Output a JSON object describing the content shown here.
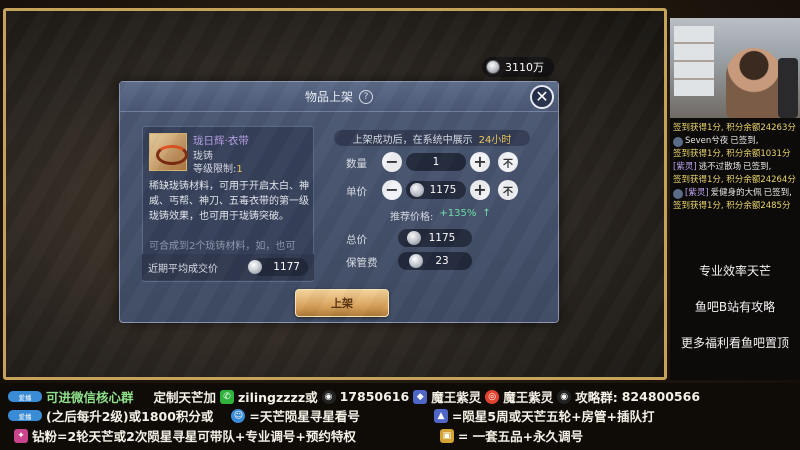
{
  "currency": {
    "icon": "silver-coin-icon",
    "amount": "3110万"
  },
  "dialog": {
    "title": "物品上架",
    "help_icon": "?",
    "close_icon": "✕",
    "item": {
      "name": "珑日辉·衣带",
      "type": "珑铸",
      "level_label": "等级限制:",
      "level_value": "1",
      "description": "稀缺珑铸材料，可用于开启太白、神威、丐帮、神刀、五毒衣带的第一级珑铸效果，也可用于珑铸突破。",
      "description_more": "可合成到2个珑铸材料，如，也可"
    },
    "avg_price_label": "近期平均成交价",
    "avg_price_value": "1177",
    "info_prefix": "上架成功后，在系统中展示",
    "info_duration": "24小时",
    "quantity_label": "数量",
    "quantity_value": "1",
    "unit_price_label": "单价",
    "unit_price_value": "1175",
    "recommend_label": "推荐价格:",
    "recommend_value": "+135%",
    "recommend_arrow": "↑",
    "total_label": "总价",
    "total_value": "1175",
    "fee_label": "保管费",
    "fee_value": "23",
    "minus": "−",
    "plus": "+",
    "max": "不",
    "submit_label": "上架"
  },
  "sidebar": {
    "chat": [
      {
        "kind": "sys",
        "text": "签到获得1分, 积分余额24263分"
      },
      {
        "kind": "user",
        "tag": "",
        "name": "Seven兮夜",
        "text": "已签到,"
      },
      {
        "kind": "sys",
        "text": "签到获得1分, 积分余额1031分"
      },
      {
        "kind": "user",
        "tag": "[紫灵]",
        "name": "逃不过散场",
        "text": "已签到,"
      },
      {
        "kind": "sys",
        "text": "签到获得1分, 积分余额24264分"
      },
      {
        "kind": "user",
        "tag": "[紫灵]",
        "name": "爱健身的大佩",
        "text": "已签到,"
      },
      {
        "kind": "sys",
        "text": "签到获得1分, 积分余额2485分"
      }
    ],
    "promos": [
      "专业效率天芒",
      "鱼吧B站有攻略",
      "更多福利看鱼吧置顶"
    ]
  },
  "bottom": {
    "row1": {
      "badge": "爱播",
      "join": "可进微信核心群",
      "custom": "定制天芒加",
      "wechat_id": "zilingzzzz或",
      "qq_number": "17850616",
      "weibo1": "魔王紫灵",
      "weibo2": "魔王紫灵",
      "group_label": "攻略群:",
      "group_number": "824800566"
    },
    "row2": {
      "badge": "爱播",
      "text1": "(之后每升2级)或1800积分或",
      "text2": "=天芒陨星寻星看号",
      "text3": "=陨星5周或天芒五轮+房管+插队打"
    },
    "row3": {
      "text1": "钻粉=2轮天芒或2次陨星寻星可带队+专业调号+预约特权",
      "text2": "= 一套五品+永久调号"
    }
  }
}
